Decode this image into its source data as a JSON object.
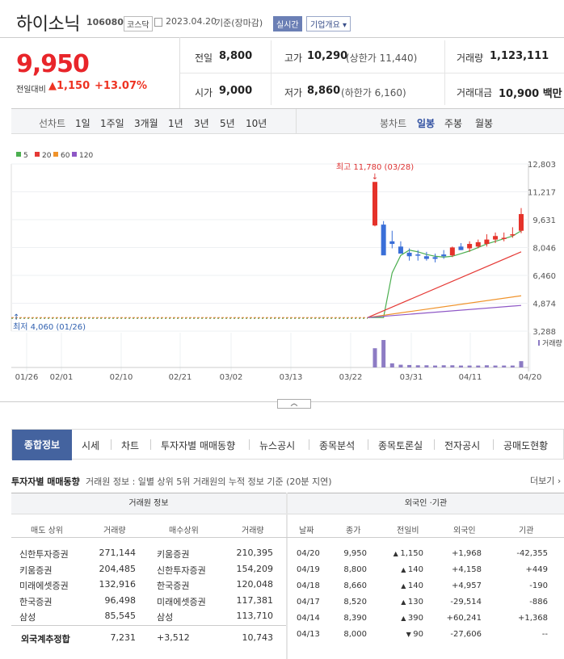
{
  "header": {
    "title": "하이소닉",
    "code": "106080",
    "market": "코스닥",
    "date": "2023.04.20",
    "basis": "기준(장마감)",
    "realtime": "실시간",
    "company_btn": "기업개요"
  },
  "quote": {
    "price": "9,950",
    "change_label": "전일대비",
    "change": "1,150",
    "change_pct": "+13.07%",
    "prev_label": "전일",
    "prev": "8,800",
    "high_label": "고가",
    "high": "10,290",
    "upper_limit": "(상한가 11,440)",
    "volume_label": "거래량",
    "volume": "1,123,111",
    "open_label": "시가",
    "open": "9,000",
    "low_label": "저가",
    "low": "8,860",
    "lower_limit": "(하한가 6,160)",
    "amount_label": "거래대금",
    "amount": "10,900 백만"
  },
  "chart_controls": {
    "line_label": "선차트",
    "periods": [
      "1일",
      "1주일",
      "3개월",
      "1년",
      "3년",
      "5년",
      "10년"
    ],
    "candle_label": "봉차트",
    "candles": [
      "일봉",
      "주봉",
      "월봉"
    ]
  },
  "chart_data": {
    "type": "candlestick",
    "legend": [
      {
        "name": "5",
        "color": "#4caf50"
      },
      {
        "name": "20",
        "color": "#e53935"
      },
      {
        "name": "60",
        "color": "#f0932b"
      },
      {
        "name": "120",
        "color": "#8e57c6"
      }
    ],
    "y_ticks": [
      "12,803",
      "11,217",
      "9,631",
      "8,046",
      "6,460",
      "4,874",
      "3,288"
    ],
    "x_ticks": [
      "01/26",
      "02/01",
      "02/10",
      "02/21",
      "03/02",
      "03/13",
      "03/22",
      "03/31",
      "04/11",
      "04/20"
    ],
    "max_label": "최고 11,780 (03/28)",
    "min_label": "최저 4,060 (01/26)",
    "volume_label": "거래량",
    "flat_price": 4060,
    "ylim": [
      3288,
      12803
    ],
    "candles": [
      [
        9300,
        11780,
        9250,
        11780
      ],
      [
        9350,
        9550,
        8100,
        7600
      ],
      [
        8400,
        9000,
        8000,
        8250
      ],
      [
        8100,
        8400,
        7900,
        7700
      ],
      [
        7750,
        8000,
        7300,
        7550
      ],
      [
        7650,
        7900,
        7300,
        7600
      ],
      [
        7550,
        7800,
        7300,
        7400
      ],
      [
        7500,
        7700,
        7200,
        7400
      ],
      [
        7650,
        7900,
        7400,
        7550
      ],
      [
        7600,
        8100,
        7500,
        8050
      ],
      [
        8100,
        8300,
        7900,
        7900
      ],
      [
        8000,
        8400,
        7800,
        8250
      ],
      [
        8100,
        8500,
        8000,
        8350
      ],
      [
        8250,
        8800,
        8100,
        8500
      ],
      [
        8500,
        8900,
        8300,
        8700
      ],
      [
        8600,
        8900,
        8400,
        8600
      ],
      [
        8800,
        9200,
        8600,
        8800
      ],
      [
        9000,
        10290,
        8860,
        9950
      ]
    ],
    "ma5": [
      4060,
      4060,
      6600,
      7600,
      7900,
      7800,
      7650,
      7550,
      7500,
      7550,
      7700,
      7850,
      8050,
      8250,
      8400,
      8550,
      8700,
      9000
    ],
    "ma20_end": 7800,
    "ma60_end": 5300,
    "ma120_end": 4750,
    "volumes": [
      0.7,
      1.0,
      0.15,
      0.1,
      0.09,
      0.08,
      0.08,
      0.07,
      0.08,
      0.08,
      0.07,
      0.07,
      0.07,
      0.08,
      0.07,
      0.07,
      0.07,
      0.23
    ]
  },
  "tabs": [
    "종합정보",
    "시세",
    "차트",
    "투자자별 매매동향",
    "뉴스공시",
    "종목분석",
    "종목토론실",
    "전자공시",
    "공매도현황"
  ],
  "investor": {
    "title": "투자자별 매매동향",
    "desc": "거래원 정보 : 일별 상위 5위 거래원의 누적 정보 기준 (20분 지연)",
    "more": "더보기",
    "broker_title": "거래원 정보",
    "foreign_title": "외국인 ·기관",
    "broker_cols": [
      "매도 상위",
      "거래량",
      "매수상위",
      "거래량"
    ],
    "foreign_cols": [
      "날짜",
      "종가",
      "전일비",
      "외국인",
      "기관"
    ],
    "brokers": [
      [
        "신한투자증권",
        "271,144",
        "키움증권",
        "210,395"
      ],
      [
        "키움증권",
        "204,485",
        "신한투자증권",
        "154,209"
      ],
      [
        "미래에셋증권",
        "132,916",
        "한국증권",
        "120,048"
      ],
      [
        "한국증권",
        "96,498",
        "미래에셋증권",
        "117,381"
      ],
      [
        "삼성",
        "85,545",
        "삼성",
        "113,710"
      ]
    ],
    "foreign_row": [
      "외국계추정합",
      "7,231",
      "+3,512",
      "10,743"
    ],
    "daily": [
      [
        "04/20",
        "9,950",
        "▲",
        "1,150",
        "+1,968",
        "-42,355"
      ],
      [
        "04/19",
        "8,800",
        "▲",
        "140",
        "+4,158",
        "+449"
      ],
      [
        "04/18",
        "8,660",
        "▲",
        "140",
        "+4,957",
        "-190"
      ],
      [
        "04/17",
        "8,520",
        "▲",
        "130",
        "-29,514",
        "-886"
      ],
      [
        "04/14",
        "8,390",
        "▲",
        "390",
        "+60,241",
        "+1,368"
      ],
      [
        "04/13",
        "8,000",
        "▼",
        "90",
        "-27,606",
        "--"
      ]
    ]
  }
}
